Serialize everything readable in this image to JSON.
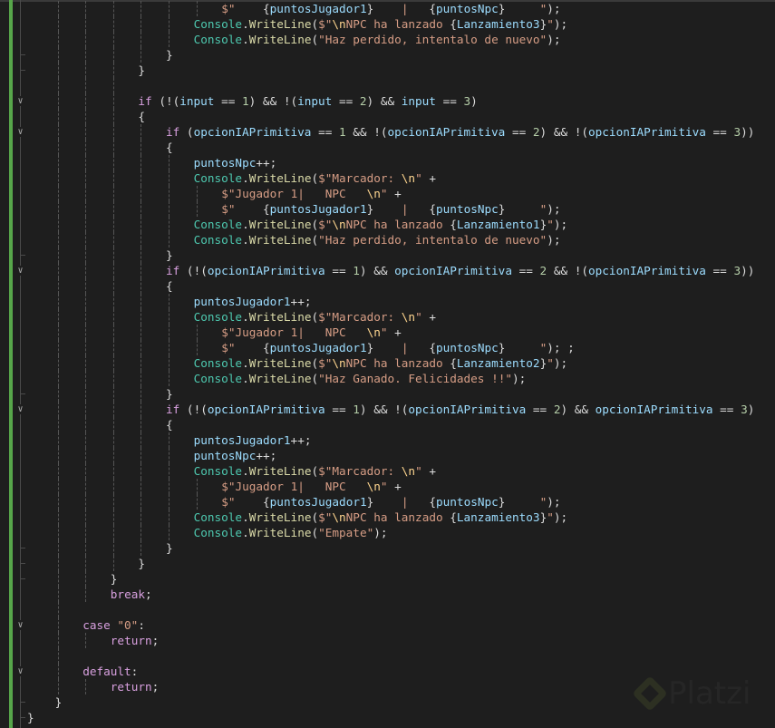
{
  "editor": {
    "language": "csharp",
    "colors": {
      "background": "#1e1e1e",
      "keyword": "#d8a0df",
      "class": "#4ec9b0",
      "method": "#dcdcaa",
      "string": "#d69d85",
      "escape": "#ffd68f",
      "identifier": "#9cdcfe",
      "number": "#b5cea8",
      "change_bar": "#57a64a"
    },
    "lines": [
      {
        "indent": 28,
        "text": "$\"    {puntosJugador1}    |   {puntosNpc}     \");"
      },
      {
        "indent": 24,
        "text": "Console.WriteLine($\"\\nNPC ha lanzado {Lanzamiento3}\");"
      },
      {
        "indent": 24,
        "text": "Console.WriteLine(\"Haz perdido, intentalo de nuevo\");"
      },
      {
        "indent": 20,
        "text": "}"
      },
      {
        "indent": 16,
        "text": "}"
      },
      {
        "indent": 16,
        "text": ""
      },
      {
        "indent": 16,
        "text": "if (!(input == 1) && !(input == 2) && input == 3)",
        "fold": true
      },
      {
        "indent": 16,
        "text": "{"
      },
      {
        "indent": 20,
        "text": "if (opcionIAPrimitiva == 1 && !(opcionIAPrimitiva == 2) && !(opcionIAPrimitiva == 3))",
        "fold": true
      },
      {
        "indent": 20,
        "text": "{"
      },
      {
        "indent": 24,
        "text": "puntosNpc++;"
      },
      {
        "indent": 24,
        "text": "Console.WriteLine($\"Marcador: \\n\" +"
      },
      {
        "indent": 28,
        "text": "$\"Jugador 1|   NPC   \\n\" +"
      },
      {
        "indent": 28,
        "text": "$\"    {puntosJugador1}    |   {puntosNpc}     \");"
      },
      {
        "indent": 24,
        "text": "Console.WriteLine($\"\\nNPC ha lanzado {Lanzamiento1}\");"
      },
      {
        "indent": 24,
        "text": "Console.WriteLine(\"Haz perdido, intentalo de nuevo\");"
      },
      {
        "indent": 20,
        "text": "}"
      },
      {
        "indent": 20,
        "text": "if (!(opcionIAPrimitiva == 1) && opcionIAPrimitiva == 2 && !(opcionIAPrimitiva == 3))",
        "fold": true
      },
      {
        "indent": 20,
        "text": "{"
      },
      {
        "indent": 24,
        "text": "puntosJugador1++;"
      },
      {
        "indent": 24,
        "text": "Console.WriteLine($\"Marcador: \\n\" +"
      },
      {
        "indent": 28,
        "text": "$\"Jugador 1|   NPC   \\n\" +"
      },
      {
        "indent": 28,
        "text": "$\"    {puntosJugador1}    |   {puntosNpc}     \"); ;"
      },
      {
        "indent": 24,
        "text": "Console.WriteLine($\"\\nNPC ha lanzado {Lanzamiento2}\");"
      },
      {
        "indent": 24,
        "text": "Console.WriteLine(\"Haz Ganado. Felicidades !!\");"
      },
      {
        "indent": 20,
        "text": "}"
      },
      {
        "indent": 20,
        "text": "if (!(opcionIAPrimitiva == 1) && !(opcionIAPrimitiva == 2) && opcionIAPrimitiva == 3)",
        "fold": true
      },
      {
        "indent": 20,
        "text": "{"
      },
      {
        "indent": 24,
        "text": "puntosJugador1++;"
      },
      {
        "indent": 24,
        "text": "puntosNpc++;"
      },
      {
        "indent": 24,
        "text": "Console.WriteLine($\"Marcador: \\n\" +"
      },
      {
        "indent": 28,
        "text": "$\"Jugador 1|   NPC   \\n\" +"
      },
      {
        "indent": 28,
        "text": "$\"    {puntosJugador1}    |   {puntosNpc}     \");"
      },
      {
        "indent": 24,
        "text": "Console.WriteLine($\"\\nNPC ha lanzado {Lanzamiento3}\");"
      },
      {
        "indent": 24,
        "text": "Console.WriteLine(\"Empate\");"
      },
      {
        "indent": 20,
        "text": "}"
      },
      {
        "indent": 16,
        "text": "}"
      },
      {
        "indent": 12,
        "text": "}"
      },
      {
        "indent": 12,
        "text": "break;"
      },
      {
        "indent": 8,
        "text": ""
      },
      {
        "indent": 8,
        "text": "case \"0\":",
        "fold": true
      },
      {
        "indent": 12,
        "text": "return;"
      },
      {
        "indent": 8,
        "text": ""
      },
      {
        "indent": 8,
        "text": "default:",
        "fold": true
      },
      {
        "indent": 12,
        "text": "return;"
      },
      {
        "indent": 4,
        "text": "}"
      },
      {
        "indent": 0,
        "text": "}"
      }
    ]
  },
  "watermark": {
    "text": "Platzi"
  }
}
